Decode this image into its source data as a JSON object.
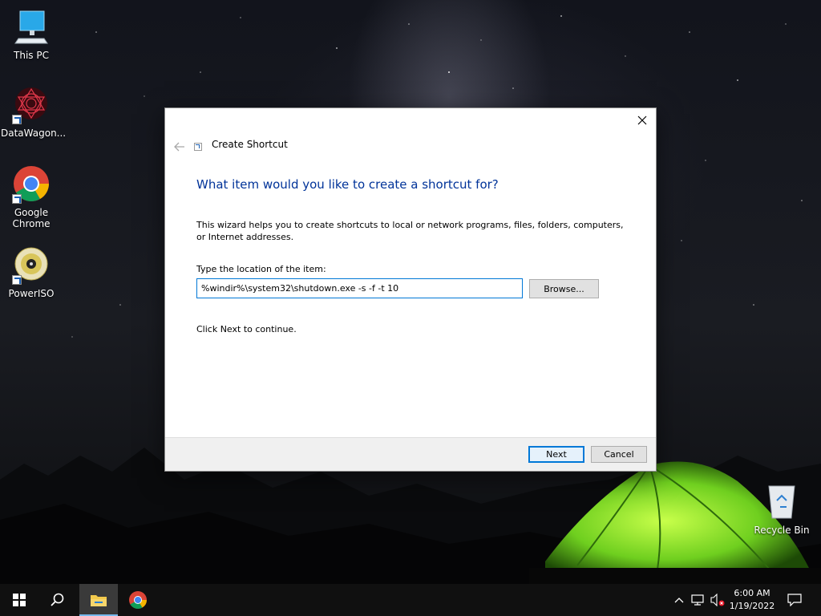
{
  "desktop": {
    "icons": [
      {
        "label": "This PC",
        "icon": "computer-icon"
      },
      {
        "label": "DataWagon...",
        "icon": "datawagon-app-icon"
      },
      {
        "label": "Google Chrome",
        "icon": "chrome-icon"
      },
      {
        "label": "PowerISO",
        "icon": "poweriso-icon"
      },
      {
        "label": "Recycle Bin",
        "icon": "recycle-bin-icon"
      }
    ]
  },
  "dialog": {
    "title": "Create Shortcut",
    "heading": "What item would you like to create a shortcut for?",
    "description": "This wizard helps you to create shortcuts to local or network programs, files, folders, computers, or Internet addresses.",
    "field_label": "Type the location of the item:",
    "location_value": "%windir%\\system32\\shutdown.exe -s -f -t 10",
    "browse_label": "Browse...",
    "hint": "Click Next to continue.",
    "next_label": "Next",
    "cancel_label": "Cancel",
    "accent_color": "#003399",
    "focus_color": "#0078d7"
  },
  "taskbar": {
    "buttons": [
      "start-icon",
      "search-icon",
      "file-explorer-icon",
      "chrome-icon"
    ],
    "tray": [
      "chevron-up-icon",
      "network-icon",
      "volume-muted-icon",
      "notification-icon"
    ],
    "time": "6:00 AM",
    "date": "1/19/2022"
  }
}
